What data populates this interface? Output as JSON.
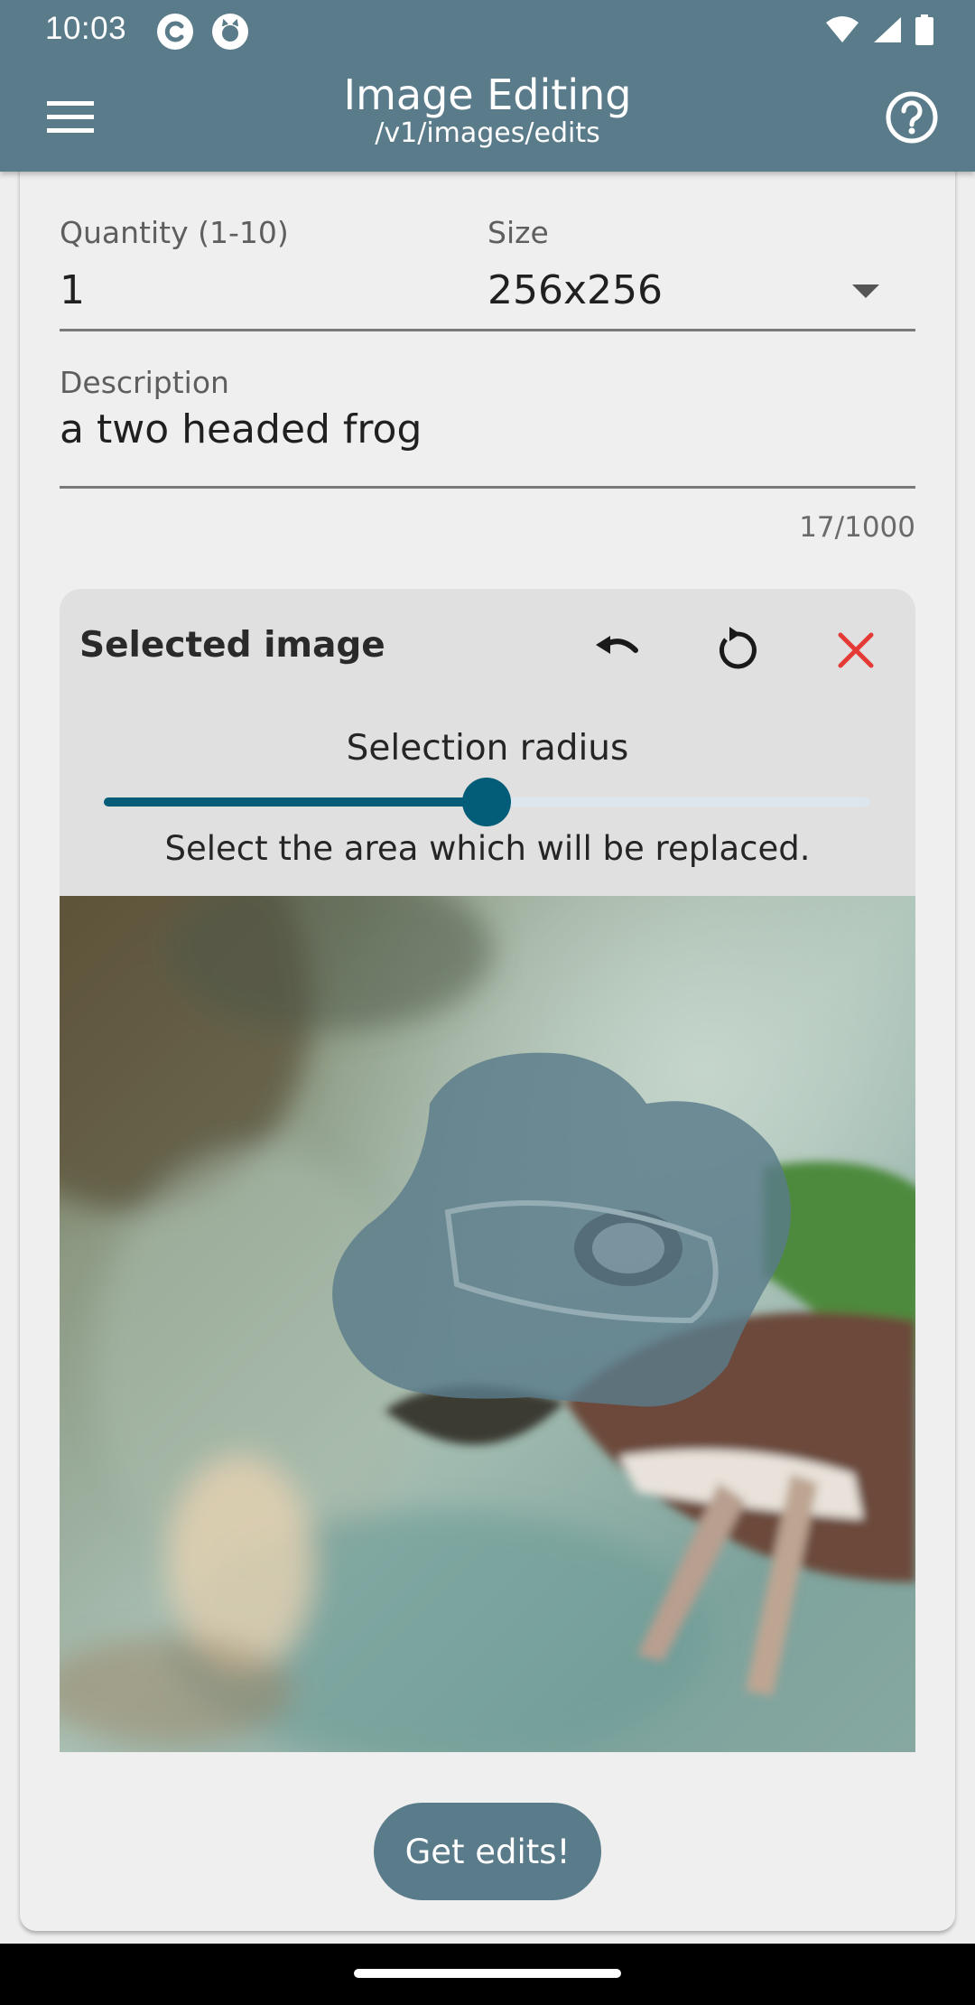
{
  "status_bar": {
    "time": "10:03",
    "icons": [
      "app-notification-icon",
      "github-icon",
      "wifi-icon",
      "signal-icon",
      "battery-icon"
    ]
  },
  "app_bar": {
    "title": "Image Editing",
    "subtitle": "/v1/images/edits",
    "menu_icon": "hamburger-menu-icon",
    "help_icon": "help-circle-icon"
  },
  "form": {
    "quantity": {
      "label": "Quantity (1-10)",
      "value": "1"
    },
    "size": {
      "label": "Size",
      "value": "256x256"
    },
    "description": {
      "label": "Description",
      "value": "a two headed frog",
      "counter": "17/1000"
    }
  },
  "selected_image": {
    "title": "Selected image",
    "undo_icon": "undo-icon",
    "reset_icon": "reset-icon",
    "close_icon": "close-icon",
    "radius_label": "Selection radius",
    "radius_value_fraction": 0.5,
    "hint": "Select the area which will be replaced."
  },
  "submit": {
    "label": "Get edits!"
  },
  "colors": {
    "primary": "#5a7b8a",
    "slider": "#035c78",
    "close": "#e53935",
    "background": "#eeeeee"
  }
}
